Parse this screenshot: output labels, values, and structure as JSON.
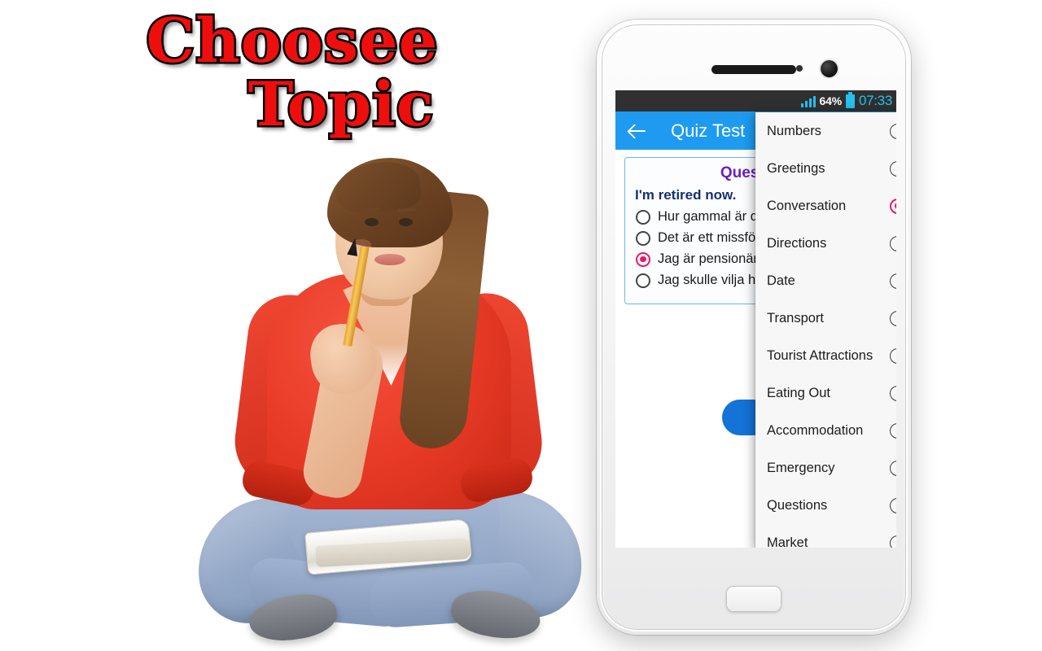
{
  "promo": {
    "line1": "Choosee",
    "line2": "Topic",
    "text_color": "#ee0e0e",
    "outline_color": "#000000"
  },
  "photo": {
    "alt": "young woman sitting cross-legged holding a pencil, thinking, with notebooks on her lap"
  },
  "phone": {
    "status_bar": {
      "signal_icon": "signal-bars-icon",
      "battery_percent": "64%",
      "battery_icon": "battery-icon",
      "clock": "07:33",
      "background": "#303030",
      "accent": "#25c0ee"
    },
    "app_bar": {
      "back_icon": "back-arrow-icon",
      "title": "Quiz Test",
      "background": "#1e9bf0"
    },
    "quiz_card": {
      "heading": "Question",
      "question": "I'm retired now.",
      "heading_color": "#6a1ec4",
      "question_color": "#17306b",
      "answers": [
        {
          "text": "Hur gammal är du?",
          "selected": false
        },
        {
          "text": "Det är ett missförstånd.",
          "selected": false
        },
        {
          "text": "Jag är pensionär nu.",
          "selected": true
        },
        {
          "text": "Jag skulle vilja ha en öl.",
          "selected": false
        }
      ]
    },
    "action_button": {
      "label": "",
      "color": "#1473d6"
    },
    "dialog": {
      "selected_color": "#e8186a",
      "topics": [
        {
          "label": "Numbers",
          "selected": false
        },
        {
          "label": "Greetings",
          "selected": false
        },
        {
          "label": "Conversation",
          "selected": true
        },
        {
          "label": "Directions",
          "selected": false
        },
        {
          "label": "Date",
          "selected": false
        },
        {
          "label": "Transport",
          "selected": false
        },
        {
          "label": "Tourist Attractions",
          "selected": false
        },
        {
          "label": "Eating Out",
          "selected": false
        },
        {
          "label": "Accommodation",
          "selected": false
        },
        {
          "label": "Emergency",
          "selected": false
        },
        {
          "label": "Questions",
          "selected": false
        },
        {
          "label": "Market",
          "selected": false
        }
      ]
    }
  }
}
